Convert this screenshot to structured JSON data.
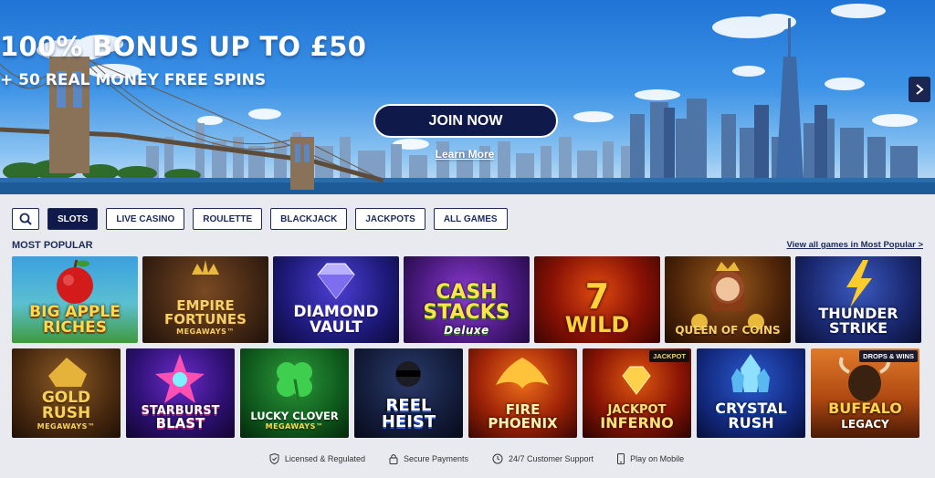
{
  "hero": {
    "title": "100% BONUS UP TO £50",
    "subtitle": "+ 50 REAL MONEY FREE SPINS",
    "cta_label": "JOIN NOW",
    "learn_more": "Learn More"
  },
  "filters": {
    "search_icon": "search-icon",
    "items": [
      "SLOTS",
      "LIVE CASINO",
      "ROULETTE",
      "BLACKJACK",
      "JACKPOTS",
      "ALL GAMES"
    ],
    "active": "SLOTS"
  },
  "section": {
    "title": "MOST POPULAR",
    "view_all": "View all games in Most Popular >"
  },
  "games_row1": [
    {
      "title": "BIG APPLE",
      "title2": "RICHES",
      "sub": ""
    },
    {
      "title": "EMPIRE",
      "title2": "FORTUNES",
      "sub": "MEGAWAYS™"
    },
    {
      "title": "DIAMOND",
      "title2": "VAULT",
      "sub": ""
    },
    {
      "title": "CASH",
      "title2": "STACKS",
      "sub": "Deluxe"
    },
    {
      "title": "7",
      "title2": "WILD",
      "sub": ""
    },
    {
      "title": "QUEEN OF COINS",
      "title2": "",
      "sub": ""
    },
    {
      "title": "THUNDER",
      "title2": "STRIKE",
      "sub": ""
    }
  ],
  "games_row2": [
    {
      "title": "GOLD",
      "title2": "RUSH",
      "sub": "MEGAWAYS™"
    },
    {
      "title": "STARBURST",
      "title2": "BLAST",
      "sub": ""
    },
    {
      "title": "LUCKY CLOVER",
      "title2": "",
      "sub": "MEGAWAYS™"
    },
    {
      "title": "REEL",
      "title2": "HEIST",
      "sub": ""
    },
    {
      "title": "FIRE",
      "title2": "PHOENIX",
      "sub": ""
    },
    {
      "title": "JACKPOT",
      "title2": "INFERNO",
      "sub": "",
      "badge": "JACKPOT"
    },
    {
      "title": "CRYSTAL",
      "title2": "RUSH",
      "sub": ""
    },
    {
      "title": "BUFFALO",
      "title2": "LEGACY",
      "sub": "",
      "badge": "DROPS & WINS"
    }
  ],
  "trust": [
    {
      "label": "Licensed & Regulated",
      "icon": "shield-check-icon"
    },
    {
      "label": "Secure Payments",
      "icon": "lock-icon"
    },
    {
      "label": "24/7 Customer Support",
      "icon": "clock-icon"
    },
    {
      "label": "Play on Mobile",
      "icon": "mobile-icon"
    }
  ],
  "colors": {
    "navy": "#0f1a4a",
    "page_bg": "#e9eaf0"
  }
}
